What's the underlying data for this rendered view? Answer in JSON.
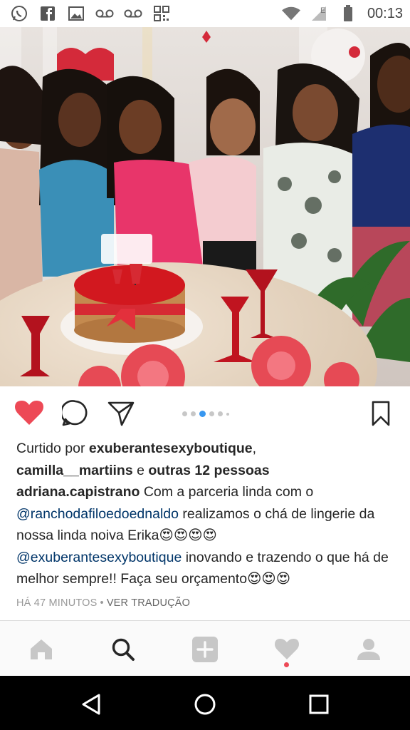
{
  "status_bar": {
    "time": "00:13",
    "icons": [
      "whatsapp-icon",
      "facebook-icon",
      "gallery-icon",
      "voicemail-icon",
      "voicemail-icon",
      "qr-icon"
    ],
    "right_icons": [
      "wifi-icon",
      "signal-icon",
      "battery-icon"
    ]
  },
  "post": {
    "image_alt": "Group photo at lingerie shower with cake",
    "carousel": {
      "count": 6,
      "active_index": 2
    },
    "likes": {
      "prefix": "Curtido por ",
      "user1": "exuberantesexyboutique",
      "comma": ",",
      "user2": "camilla__martiins",
      "and": " e ",
      "others": "outras 12 pessoas"
    },
    "caption": {
      "author": "adriana.capistrano",
      "text1": " Com a parceria linda com o",
      "mention1": "@ranchodafiloedoednaldo",
      "text2": " realizamos o chá de lingerie da nossa linda noiva Erika",
      "emojis1": "😍😍😍😍",
      "mention2": "@exuberantesexyboutique",
      "text3": " inovando e trazendo o que há de melhor sempre!! Faça seu orçamento",
      "emojis2": "😍😍😍"
    },
    "time_ago": "HÁ 47 MINUTOS",
    "separator": "•",
    "translate": "VER TRADUÇÃO"
  },
  "colors": {
    "like_red": "#ed4956",
    "carousel_blue": "#3897f0",
    "mention_blue": "#003569"
  },
  "tabs": [
    "home-icon",
    "search-icon",
    "add-icon",
    "activity-icon",
    "profile-icon"
  ],
  "nav": [
    "back-icon",
    "home-nav-icon",
    "recents-icon"
  ]
}
